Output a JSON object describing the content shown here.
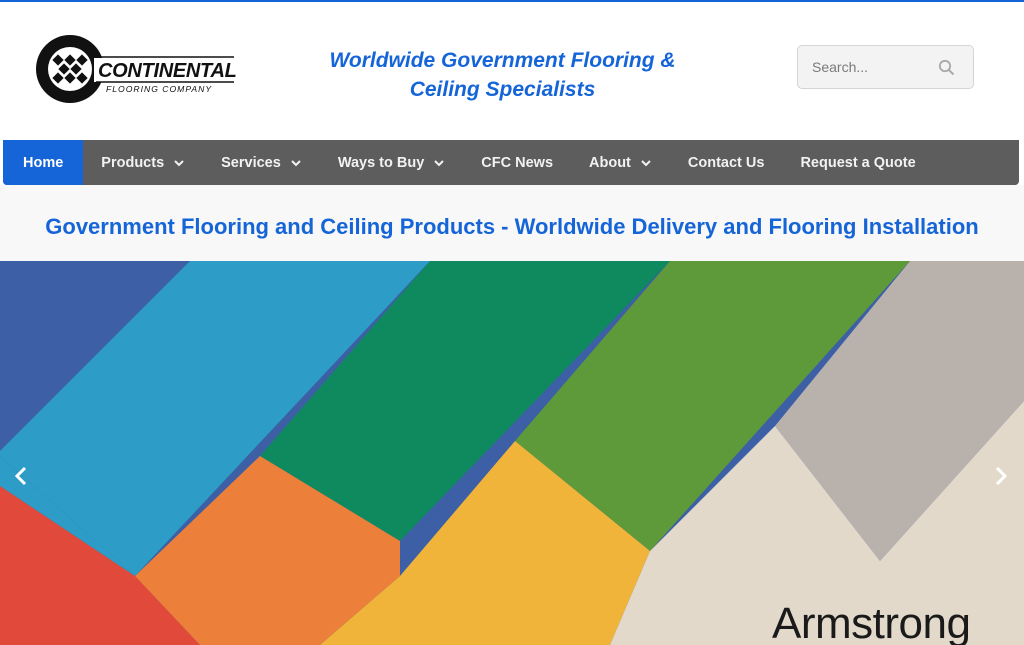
{
  "header": {
    "logo": {
      "brand_name": "CONTINENTAL",
      "brand_sub": "FLOORING COMPANY"
    },
    "tagline_line1": "Worldwide Government Flooring &",
    "tagline_line2": "Ceiling Specialists",
    "search": {
      "placeholder": "Search...",
      "icon": "search-icon"
    }
  },
  "nav": {
    "items": [
      {
        "label": "Home",
        "active": true,
        "has_dropdown": false
      },
      {
        "label": "Products",
        "has_dropdown": true
      },
      {
        "label": "Services",
        "has_dropdown": true
      },
      {
        "label": "Ways to Buy",
        "has_dropdown": true
      },
      {
        "label": "CFC News",
        "has_dropdown": false
      },
      {
        "label": "About",
        "has_dropdown": true
      },
      {
        "label": "Contact Us",
        "has_dropdown": false
      },
      {
        "label": "Request a Quote",
        "has_dropdown": false
      }
    ]
  },
  "main": {
    "headline": "Government Flooring and Ceiling Products - Worldwide Delivery and Flooring Installation"
  },
  "hero": {
    "brand_name": "Armstrong",
    "prev_icon": "chevron-left-icon",
    "next_icon": "chevron-right-icon"
  },
  "colors": {
    "accent": "#1565d8",
    "nav_bg": "#5d5d5d",
    "tile_navy": "#3c5fa6",
    "tile_cyan": "#2d9cc7",
    "tile_green": "#0f8a5e",
    "tile_olive": "#5f9a3a",
    "tile_grey": "#b9b2ac",
    "tile_red": "#e14a3b",
    "tile_orange": "#ec7f3a",
    "tile_yellow": "#f0b43a",
    "tile_beige": "#e2d9cb"
  }
}
